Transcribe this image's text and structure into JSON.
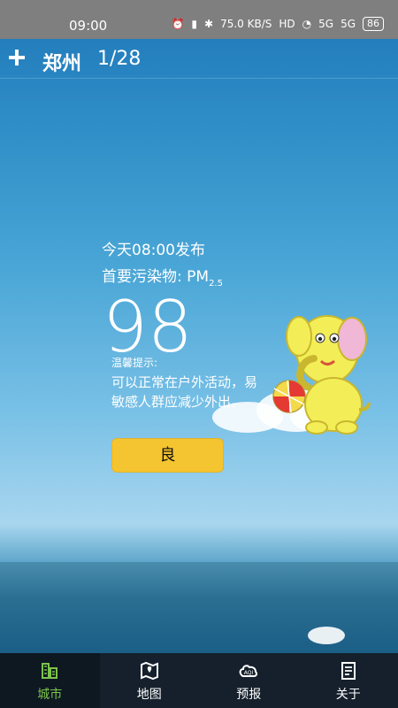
{
  "status_bar": {
    "time": "09:00",
    "net_speed_value": "75.0",
    "net_speed_unit": "KB/S",
    "hd_badge": "HD",
    "signal_1": "5G",
    "signal_2": "5G",
    "battery_level": "86"
  },
  "header": {
    "city": "郑州",
    "page_indicator": "1/28"
  },
  "aqi": {
    "publish_time": "今天08:00发布",
    "pollutant_prefix": "首要污染物: PM",
    "pollutant_subscript": "2.5",
    "value": "98",
    "tip_label": "温馨提示:",
    "tip_text": "可以正常在户外活动，易敏感人群应减少外出。",
    "quality_label": "良"
  },
  "bottom_nav": [
    {
      "label": "城市",
      "icon": "city-icon",
      "active": true
    },
    {
      "label": "地图",
      "icon": "map-icon",
      "active": false
    },
    {
      "label": "预报",
      "icon": "aqi-forecast-icon",
      "active": false
    },
    {
      "label": "关于",
      "icon": "about-icon",
      "active": false
    }
  ],
  "colors": {
    "status_bar_bg": "#7f7f7f",
    "quality_good": "#f4c431",
    "nav_bg": "#15202c",
    "nav_active": "#7cc24b"
  }
}
